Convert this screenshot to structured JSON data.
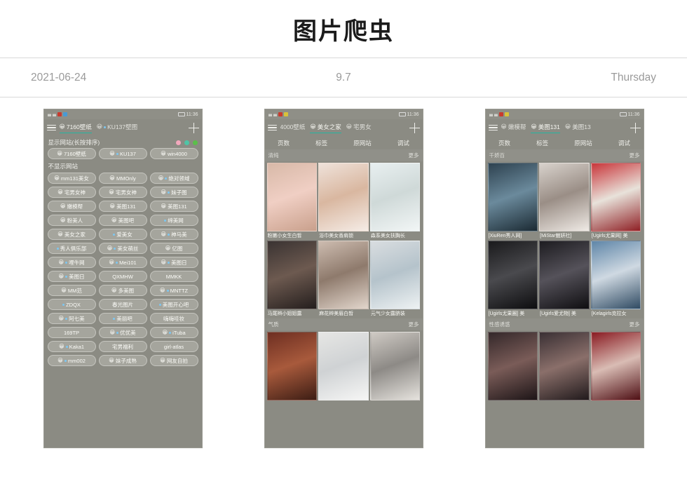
{
  "header": {
    "title": "图片爬虫",
    "date": "2021-06-24",
    "version": "9.7",
    "weekday": "Thursday"
  },
  "phones": [
    {
      "name": "settings-screen",
      "status": {
        "time": "11:36"
      },
      "tabs": [
        {
          "label": "7160壁纸",
          "emoji": "😀",
          "active": true,
          "dot": false
        },
        {
          "label": "KU137壁图",
          "emoji": "😀",
          "active": false,
          "dot": true
        }
      ],
      "show_sites_label": "显示网站(长按排序)",
      "hidden_sites_label": "不显示网站",
      "shown_chips": [
        {
          "label": "7160壁纸",
          "emoji": "😀",
          "dot": false
        },
        {
          "label": "KU137",
          "emoji": "😀",
          "dot": true
        },
        {
          "label": "win4000",
          "emoji": "😀",
          "dot": false
        }
      ],
      "hidden_chips": [
        {
          "label": "mm131美女",
          "emoji": "😀",
          "dot": false
        },
        {
          "label": "MMOnly",
          "emoji": "😀",
          "dot": false
        },
        {
          "label": "绝对领域",
          "emoji": "😀",
          "dot": true
        },
        {
          "label": "宅男女神",
          "emoji": "😀",
          "dot": false
        },
        {
          "label": "宅男女神",
          "emoji": "😀",
          "dot": false
        },
        {
          "label": "妹子图",
          "emoji": "😀",
          "dot": true
        },
        {
          "label": "嫩模帮",
          "emoji": "😀",
          "dot": false
        },
        {
          "label": "美图131",
          "emoji": "😀",
          "dot": false
        },
        {
          "label": "美图131",
          "emoji": "😀",
          "dot": false
        },
        {
          "label": "粉美人",
          "emoji": "😀",
          "dot": false
        },
        {
          "label": "美图吧",
          "emoji": "😀",
          "dot": false
        },
        {
          "label": "缔美网",
          "emoji": "",
          "dot": true
        },
        {
          "label": "美女之家",
          "emoji": "😀",
          "dot": false
        },
        {
          "label": "爱美女",
          "emoji": "",
          "dot": true
        },
        {
          "label": "神马美",
          "emoji": "😀",
          "dot": true
        },
        {
          "label": "秀人俱乐部",
          "emoji": "",
          "dot": true
        },
        {
          "label": "美女萌丝",
          "emoji": "😀",
          "dot": true
        },
        {
          "label": "亿图",
          "emoji": "😀",
          "dot": false
        },
        {
          "label": "哩牛网",
          "emoji": "😀",
          "dot": true
        },
        {
          "label": "Mei101",
          "emoji": "😀",
          "dot": true
        },
        {
          "label": "美图日",
          "emoji": "😀",
          "dot": true
        },
        {
          "label": "美图日",
          "emoji": "😀",
          "dot": true
        },
        {
          "label": "QXMHW",
          "emoji": "",
          "dot": false
        },
        {
          "label": "MMKK",
          "emoji": "",
          "dot": false
        },
        {
          "label": "MM范",
          "emoji": "😀",
          "dot": false
        },
        {
          "label": "多美图",
          "emoji": "😀",
          "dot": false
        },
        {
          "label": "MNTTZ",
          "emoji": "😀",
          "dot": true
        },
        {
          "label": "ZDQX",
          "emoji": "",
          "dot": true
        },
        {
          "label": "春光图片",
          "emoji": "",
          "dot": false
        },
        {
          "label": "美图开心吧",
          "emoji": "",
          "dot": true
        },
        {
          "label": "阿七美",
          "emoji": "😀",
          "dot": true
        },
        {
          "label": "美丽吧",
          "emoji": "",
          "dot": true
        },
        {
          "label": "嗨嗨哇妆",
          "emoji": "",
          "dot": false
        },
        {
          "label": "169TP",
          "emoji": "",
          "dot": false
        },
        {
          "label": "优优美",
          "emoji": "😀",
          "dot": true
        },
        {
          "label": "iTuba",
          "emoji": "😀",
          "dot": true
        },
        {
          "label": "Kaka1",
          "emoji": "😀",
          "dot": true
        },
        {
          "label": "宅男福利",
          "emoji": "",
          "dot": false
        },
        {
          "label": "girl-atlas",
          "emoji": "",
          "dot": false
        },
        {
          "label": "mm002",
          "emoji": "😀",
          "dot": true
        },
        {
          "label": "妹子成熟",
          "emoji": "😀",
          "dot": false
        },
        {
          "label": "网友自拍",
          "emoji": "😀",
          "dot": false
        }
      ]
    },
    {
      "name": "gallery-screen-light",
      "status": {
        "time": "11:36"
      },
      "tabs": [
        {
          "label": "4000壁纸",
          "emoji": "",
          "active": false,
          "dot": false
        },
        {
          "label": "美女之家",
          "emoji": "😀",
          "active": true,
          "dot": false
        },
        {
          "label": "宅男女",
          "emoji": "😀",
          "active": false,
          "dot": false
        }
      ],
      "subtabs": [
        "页数",
        "标签",
        "原网站",
        "调试"
      ],
      "sections": [
        {
          "title": "清纯",
          "more": "更多"
        },
        {
          "title": "气质",
          "more": "更多"
        }
      ],
      "rows": [
        {
          "captions": [
            "粉嫩小女生白皙",
            "浴巾美女香肩锁",
            "森系美女扶胸长"
          ],
          "colors": [
            "#d8b9a8,#f0cfc4,#c9a08c",
            "#efe2da,#d9b7a0,#f5ece6",
            "#e8eff0,#cfd9d8,#f2f6f6"
          ]
        },
        {
          "captions": [
            "马尾辫小姐姐露",
            "麻花辫美眉白皙",
            "元气少女露脐装"
          ],
          "colors": [
            "#3a3332,#6d5a50,#241e1d",
            "#cdbcb0,#8e7a6c,#e2d6cc",
            "#d9dde0,#b5c3cb,#eef2f3"
          ]
        },
        {
          "captions": [
            "",
            "",
            ""
          ],
          "colors": [
            "#6e2f22,#a85a3c,#3c1d14",
            "#e6e6e4,#cfd2d4,#f6f6f5",
            "#cfcac4,#8d8a86,#e6e3de"
          ]
        }
      ]
    },
    {
      "name": "gallery-screen-dark",
      "status": {
        "time": "11:36"
      },
      "tabs": [
        {
          "label": "嫩模帮",
          "emoji": "😀",
          "active": false,
          "dot": false
        },
        {
          "label": "美图131",
          "emoji": "😀",
          "active": true,
          "dot": false
        },
        {
          "label": "美图13",
          "emoji": "😀",
          "active": false,
          "dot": false
        }
      ],
      "subtabs": [
        "页数",
        "标签",
        "原网站",
        "调试"
      ],
      "sections": [
        {
          "title": "千娇百",
          "more": "更多"
        },
        {
          "title": "性感诱惑",
          "more": "更多"
        }
      ],
      "rows": [
        {
          "captions": [
            "[XiuRen秀人网]",
            "[MiStar魅妍社]",
            "[Ugirls尤果网] 美"
          ],
          "colors": [
            "#2e4250,#6b8a9c,#1b2a33",
            "#d8d2cc,#9a8e86,#efeae5",
            "#c9353a,#e8e2da,#8f1f24"
          ]
        },
        {
          "captions": [
            "[Ugirls尤果圈] 美",
            "[Ugirls爱尤物] 美",
            "[Kelagirls克拉女"
          ],
          "colors": [
            "#1a1a1c,#4a4a4e,#0d0d0f",
            "#1d1c20,#55525a,#0f0e11",
            "#5f86a8,#cfd9e2,#2f4a62"
          ]
        },
        {
          "captions": [
            "",
            "",
            ""
          ],
          "colors": [
            "#34282a,#7a5c58,#1d1517",
            "#3a3034,#8a6f6a,#211a1c",
            "#8a1b22,#d9bcb4,#4e0f14"
          ]
        }
      ]
    }
  ]
}
